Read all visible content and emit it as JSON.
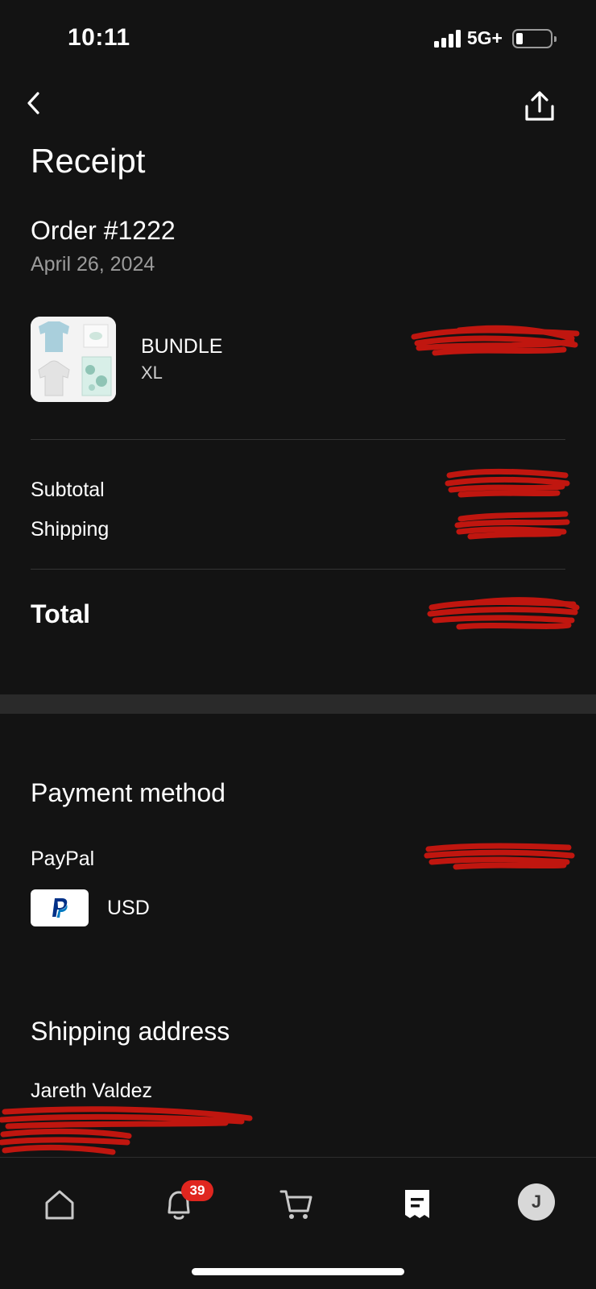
{
  "status_bar": {
    "time": "10:11",
    "network": "5G+"
  },
  "header": {
    "title": "Receipt"
  },
  "order": {
    "title": "Order #1222",
    "date": "April 26, 2024"
  },
  "item": {
    "name": "BUNDLE",
    "variant": "XL"
  },
  "summary": {
    "subtotal_label": "Subtotal",
    "shipping_label": "Shipping",
    "total_label": "Total"
  },
  "payment": {
    "title": "Payment method",
    "provider": "PayPal",
    "currency": "USD"
  },
  "shipping": {
    "title": "Shipping address",
    "name": "Jareth Valdez"
  },
  "tab_bar": {
    "notifications_badge": "39",
    "avatar_initial": "J"
  },
  "colors": {
    "background": "#131313",
    "redaction": "#c0160f",
    "badge": "#e0261f",
    "paypal_blue": "#003087"
  },
  "icons": [
    "back-arrow-icon",
    "share-icon",
    "home-icon",
    "bell-icon",
    "cart-icon",
    "receipt-icon",
    "paypal-logo"
  ]
}
